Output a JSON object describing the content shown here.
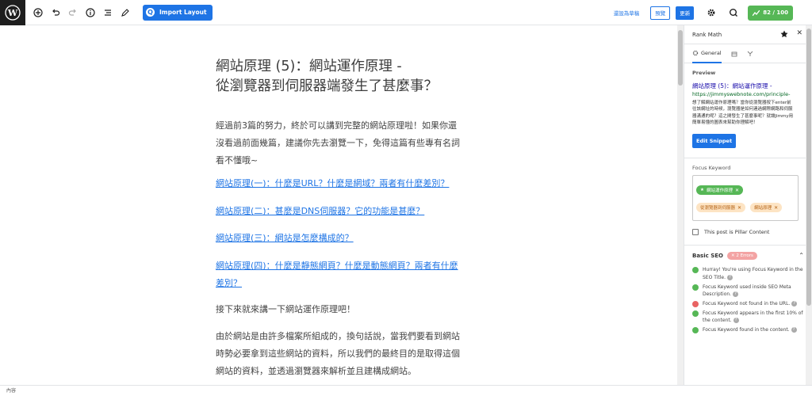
{
  "toolbar": {
    "import_label": "Import Layout",
    "draft_link": "還設為草稿",
    "preview_label": "預覽",
    "update_label": "更新",
    "score": "82 / 100"
  },
  "editor": {
    "title_line1": "網站原理 (5)：網站運作原理 -",
    "title_line2": "從瀏覽器到伺服器端發生了甚麼事？",
    "paragraphs": [
      "經過前3篇的努力，終於可以講到完整的網站原理啦！如果你還沒看過前面幾篇，建議你先去瀏覽一下，免得這篇有些專有名詞看不懂哦~",
      "網站原理(一)：什麼是URL？什麼是網域？兩者有什麼差別？",
      "網站原理(二)：甚麼是DNS伺服器？它的功能是甚麼？",
      "網站原理(三)：網站是怎麼構成的？",
      "網站原理(四)：什麼是靜態網頁？什麼是動態網頁？兩者有什麼差別？",
      "接下來就來講一下網站運作原理吧！",
      "由於網站是由許多檔案所組成的，換句話說，當我們要看到網站時勢必要拿到這些網站的資料，所以我們的最終目的是取得這個網站的資料，並透過瀏覽器來解析並且建構成網站。"
    ]
  },
  "sidebar": {
    "title": "Rank Math",
    "tab_general": "General",
    "preview_label": "Preview",
    "snippet_title": "網站原理 (5)：網站運作原理 -",
    "snippet_url": "https://jimmyswebnote.com/principle-",
    "snippet_desc": "想了解網站運作原理嗎？當你從瀏覽器按下enter前往該網址的時候，瀏覽器是如何連過網際網路和伺服器溝通的呢？這之間發生了甚麼事呢？就讓Jimmy用簡單易懂的圖表來幫助你理解吧！",
    "edit_snippet": "Edit Snippet",
    "focus_keyword_label": "Focus Keyword",
    "keywords": [
      {
        "label": "網站運作原理",
        "type": "primary"
      },
      {
        "label": "從瀏覽器到伺服器",
        "type": "sec"
      },
      {
        "label": "網站原理",
        "type": "sec"
      }
    ],
    "pillar_label": "This post is Pillar Content",
    "basic_seo_label": "Basic SEO",
    "errors_badge": "✕ 2 Errors",
    "checks": [
      {
        "text": "Hurray! You're using Focus Keyword in the SEO Title.",
        "status": "ok"
      },
      {
        "text": "Focus Keyword used inside SEO Meta Description.",
        "status": "ok"
      },
      {
        "text": "Focus Keyword not found in the URL.",
        "status": "bad"
      },
      {
        "text": "Focus Keyword appears in the first 10% of the content.",
        "status": "ok"
      },
      {
        "text": "Focus Keyword found in the content.",
        "status": "ok"
      }
    ]
  },
  "footer": {
    "status": "內容"
  }
}
